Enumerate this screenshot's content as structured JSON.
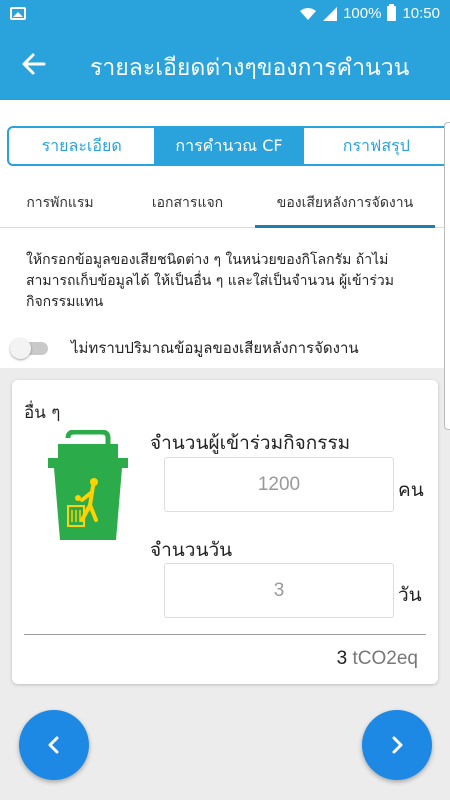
{
  "status": {
    "battery": "100%",
    "time": "10:50"
  },
  "appbar": {
    "title": "รายละเอียดต่างๆของการคำนวน"
  },
  "segment_tabs": [
    "รายละเอียด",
    "การคำนวณ CF",
    "กราฟสรุป"
  ],
  "sub_tabs": [
    "การพักแรม",
    "เอกสารแจก",
    "ของเสียหลังการจัดงาน"
  ],
  "instruction": "ให้กรอกข้อมูลของเสียชนิดต่าง ๆ ในหน่วยของกิโลกรัม ถ้าไม่สามารถเก็บข้อมูลได้ ให้เป็นอื่น ๆ และใส่เป็นจำนวน ผู้เข้าร่วมกิจกรรมแทน",
  "toggle": {
    "label": "ไม่ทราบปริมาณข้อมูลของเสียหลังการจัดงาน",
    "checked": false
  },
  "card": {
    "category": "อื่น ๆ",
    "participants_label": "จำนวนผู้เข้าร่วมกิจกรรม",
    "participants_placeholder": "1200",
    "participants_unit": "คน",
    "days_label": "จำนวนวัน",
    "days_placeholder": "3",
    "days_unit": "วัน",
    "result_value": "3",
    "result_unit": "tCO2eq"
  },
  "icons": {
    "back": "arrow-left-icon",
    "prev": "chevron-left-icon",
    "next": "chevron-right-icon",
    "bin": "trash-bin-icon"
  },
  "colors": {
    "primary": "#2aa3dc",
    "fab": "#1e88e5",
    "bin_green": "#2bab4a",
    "bin_yellow": "#ffd200"
  }
}
